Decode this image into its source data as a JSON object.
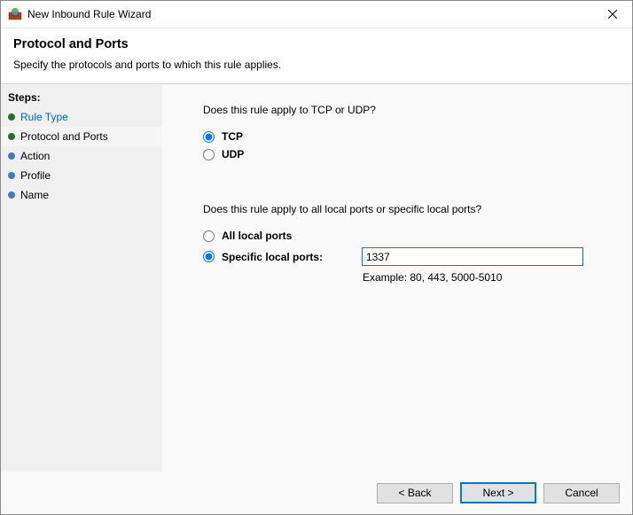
{
  "window": {
    "title": "New Inbound Rule Wizard"
  },
  "header": {
    "title": "Protocol and Ports",
    "subtitle": "Specify the protocols and ports to which this rule applies."
  },
  "sidebar": {
    "label": "Steps:",
    "items": [
      {
        "label": "Rule Type",
        "state": "done",
        "link": true
      },
      {
        "label": "Protocol and Ports",
        "state": "current",
        "link": false
      },
      {
        "label": "Action",
        "state": "future",
        "link": false
      },
      {
        "label": "Profile",
        "state": "future",
        "link": false
      },
      {
        "label": "Name",
        "state": "future",
        "link": false
      }
    ]
  },
  "main": {
    "question1": "Does this rule apply to TCP or UDP?",
    "protocol": {
      "tcp_label": "TCP",
      "udp_label": "UDP",
      "selected": "tcp"
    },
    "question2": "Does this rule apply to all local ports or specific local ports?",
    "ports": {
      "all_label": "All local ports",
      "specific_label": "Specific local ports:",
      "selected": "specific",
      "value": "1337",
      "example": "Example: 80, 443, 5000-5010"
    }
  },
  "footer": {
    "back": "< Back",
    "next": "Next >",
    "cancel": "Cancel"
  }
}
